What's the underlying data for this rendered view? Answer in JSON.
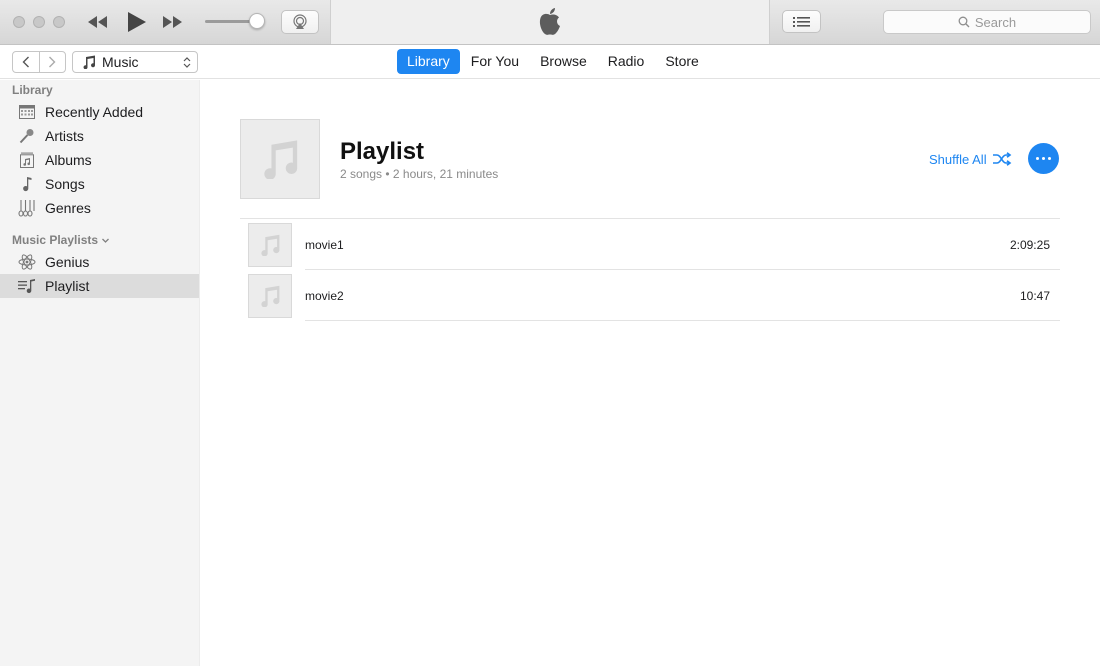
{
  "toolbar": {
    "volume_level": 0.9,
    "search_placeholder": "Search"
  },
  "navbar": {
    "media_kind": "Music",
    "tabs": [
      {
        "label": "Library",
        "active": true
      },
      {
        "label": "For You",
        "active": false
      },
      {
        "label": "Browse",
        "active": false
      },
      {
        "label": "Radio",
        "active": false
      },
      {
        "label": "Store",
        "active": false
      }
    ]
  },
  "sidebar": {
    "library_header": "Library",
    "library_items": [
      {
        "label": "Recently Added",
        "icon": "grid-calendar-icon"
      },
      {
        "label": "Artists",
        "icon": "microphone-icon"
      },
      {
        "label": "Albums",
        "icon": "album-icon"
      },
      {
        "label": "Songs",
        "icon": "music-note-icon"
      },
      {
        "label": "Genres",
        "icon": "guitars-icon"
      }
    ],
    "playlists_header": "Music Playlists",
    "playlist_items": [
      {
        "label": "Genius",
        "icon": "atom-icon",
        "selected": false
      },
      {
        "label": "Playlist",
        "icon": "playlist-icon",
        "selected": true
      }
    ]
  },
  "main": {
    "title": "Playlist",
    "meta": "2 songs • 2 hours, 21 minutes",
    "shuffle_label": "Shuffle All",
    "tracks": [
      {
        "name": "movie1",
        "duration": "2:09:25"
      },
      {
        "name": "movie2",
        "duration": "10:47"
      }
    ]
  },
  "colors": {
    "accent": "#1e86f1",
    "sidebar_bg": "#f4f4f4",
    "selected_bg": "#dcdcdc"
  }
}
